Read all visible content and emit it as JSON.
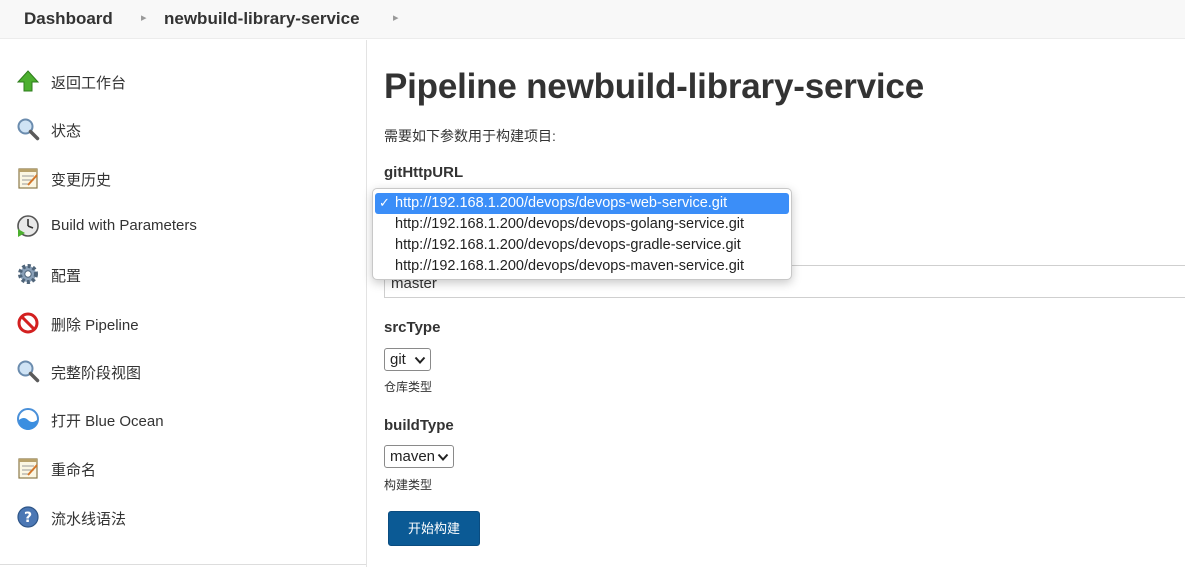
{
  "breadcrumb": {
    "items": [
      "Dashboard",
      "newbuild-library-service"
    ]
  },
  "sidebar": {
    "items": [
      {
        "label": "返回工作台",
        "icon": "up-arrow-icon"
      },
      {
        "label": "状态",
        "icon": "magnifier-icon"
      },
      {
        "label": "变更历史",
        "icon": "notepad-icon"
      },
      {
        "label": "Build with Parameters",
        "icon": "clock-play-icon"
      },
      {
        "label": "配置",
        "icon": "gear-icon"
      },
      {
        "label": "删除 Pipeline",
        "icon": "no-entry-icon"
      },
      {
        "label": "完整阶段视图",
        "icon": "magnifier-icon"
      },
      {
        "label": "打开 Blue Ocean",
        "icon": "blue-ocean-icon"
      },
      {
        "label": "重命名",
        "icon": "notepad-icon"
      },
      {
        "label": "流水线语法",
        "icon": "help-icon"
      }
    ]
  },
  "main": {
    "title": "Pipeline newbuild-library-service",
    "intro": "需要如下参数用于构建项目:",
    "params": {
      "gitHttpURL": {
        "name": "gitHttpURL",
        "options": [
          "http://192.168.1.200/devops/devops-web-service.git",
          "http://192.168.1.200/devops/devops-golang-service.git",
          "http://192.168.1.200/devops/devops-gradle-service.git",
          "http://192.168.1.200/devops/devops-maven-service.git"
        ],
        "selected_index": 0,
        "check_mark": "✓"
      },
      "branch": {
        "value": "master"
      },
      "srcType": {
        "name": "srcType",
        "value": "git",
        "description": "仓库类型"
      },
      "buildType": {
        "name": "buildType",
        "value": "maven",
        "description": "构建类型"
      }
    },
    "build_button": "开始构建"
  },
  "colors": {
    "button_bg": "#0b5a95",
    "selected_option_bg": "#3b8ef8",
    "breadcrumb_bg": "#f8f8f8"
  }
}
